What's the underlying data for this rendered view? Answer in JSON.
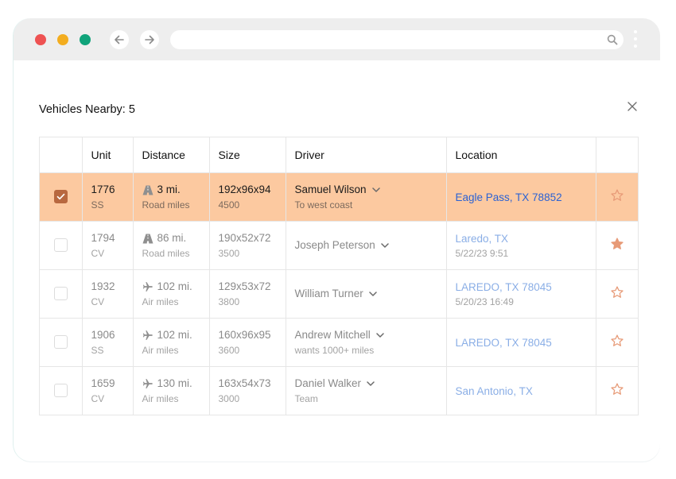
{
  "browser": {
    "traffic_colors": {
      "close": "#ee5252",
      "minimize": "#f3ad1f",
      "zoom": "#10a37a"
    },
    "icons": {
      "back": "arrow-left-icon",
      "forward": "arrow-right-icon",
      "search": "search-icon",
      "menu": "kebab-menu-icon"
    },
    "url": ""
  },
  "panel": {
    "title": "Vehicles Nearby: 5",
    "close_icon": "close-icon"
  },
  "table": {
    "headers": {
      "select": "",
      "unit": "Unit",
      "distance": "Distance",
      "size": "Size",
      "driver": "Driver",
      "location": "Location",
      "favorite": ""
    },
    "rows": [
      {
        "selected": true,
        "unit": "1776",
        "unit_type": "SS",
        "distance_icon": "road-icon",
        "distance": "3 mi.",
        "distance_type": "Road miles",
        "size": "192x96x94",
        "weight": "4500",
        "driver": "Samuel Wilson",
        "driver_note": "To west coast",
        "location": "Eagle Pass, TX 78852",
        "location_time": "",
        "favorite": false
      },
      {
        "selected": false,
        "unit": "1794",
        "unit_type": "CV",
        "distance_icon": "road-icon",
        "distance": "86 mi.",
        "distance_type": "Road miles",
        "size": "190x52x72",
        "weight": "3500",
        "driver": "Joseph Peterson",
        "driver_note": "",
        "location": "Laredo, TX",
        "location_time": "5/22/23 9:51",
        "favorite": true
      },
      {
        "selected": false,
        "unit": "1932",
        "unit_type": "CV",
        "distance_icon": "plane-icon",
        "distance": "102 mi.",
        "distance_type": "Air miles",
        "size": "129x53x72",
        "weight": "3800",
        "driver": "William Turner",
        "driver_note": "",
        "location": "LAREDO, TX 78045",
        "location_time": "5/20/23 16:49",
        "favorite": false
      },
      {
        "selected": false,
        "unit": "1906",
        "unit_type": "SS",
        "distance_icon": "plane-icon",
        "distance": "102 mi.",
        "distance_type": "Air miles",
        "size": "160x96x95",
        "weight": "3600",
        "driver": "Andrew Mitchell",
        "driver_note": "wants 1000+ miles",
        "location": "LAREDO, TX 78045",
        "location_time": "",
        "favorite": false
      },
      {
        "selected": false,
        "unit": "1659",
        "unit_type": "CV",
        "distance_icon": "plane-icon",
        "distance": "130 mi.",
        "distance_type": "Air miles",
        "size": "163x54x73",
        "weight": "3000",
        "driver": "Daniel Walker",
        "driver_note": "Team",
        "location": "San Antonio, TX",
        "location_time": "",
        "favorite": false
      }
    ]
  },
  "colors": {
    "selected_row": "#fcc9a0",
    "accent": "#b8683f",
    "link": "#2b62d4",
    "star": "#e79a77"
  }
}
